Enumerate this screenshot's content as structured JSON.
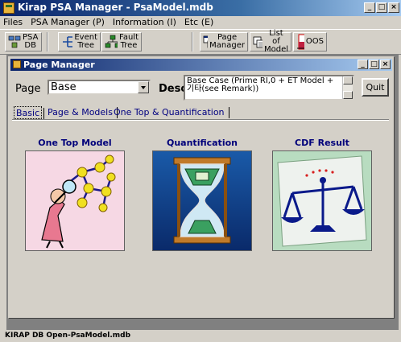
{
  "window": {
    "title": "Kirap PSA Manager - PsaModel.mdb",
    "btn_min": "_",
    "btn_max": "□",
    "btn_close": "×"
  },
  "menu": [
    {
      "label": "Files"
    },
    {
      "label": "PSA Manager (P)"
    },
    {
      "label": "Information (I)"
    },
    {
      "label": "Etc (E)"
    }
  ],
  "toolbar": {
    "psa_db": {
      "l1": "PSA",
      "l2": "DB"
    },
    "event_tree": {
      "l1": "Event",
      "l2": "Tree"
    },
    "fault_tree": {
      "l1": "Fault",
      "l2": "Tree"
    },
    "page_manager": {
      "l1": "Page",
      "l2": "Manager"
    },
    "list_of_model": {
      "l1": "List of",
      "l2": "Model"
    },
    "oos": {
      "l1": "OOS"
    }
  },
  "child": {
    "title": "Page Manager",
    "page_label": "Page",
    "page_value": "Base",
    "desc_label": "Desc",
    "desc_value": "Base Case  (Prime RI,0 + ET Model + 기타(see Remark))",
    "quit": "Quit",
    "tabs": [
      {
        "label": "Basic"
      },
      {
        "label": "Page & Models"
      },
      {
        "label": "One Top & Quantification"
      }
    ],
    "cards": [
      {
        "title": "One Top Model"
      },
      {
        "title": "Quantification"
      },
      {
        "title": "CDF Result"
      }
    ]
  },
  "status": "KIRAP DB Open-PsaModel.mdb"
}
